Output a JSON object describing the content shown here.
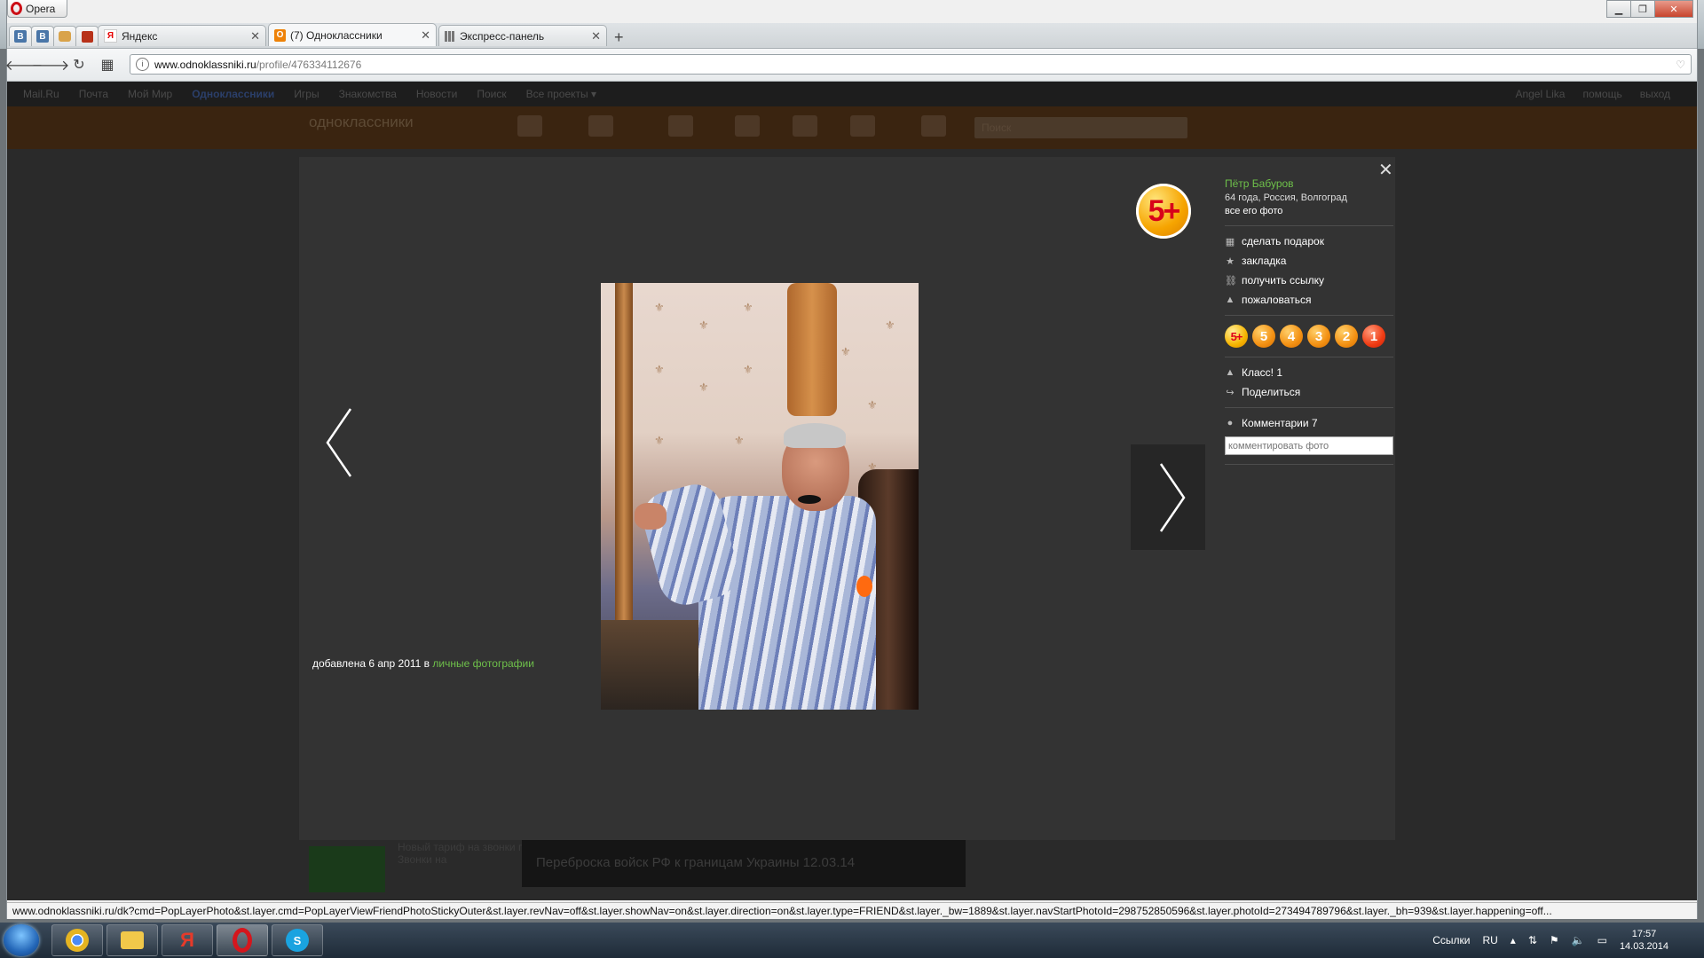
{
  "browser": {
    "app_name": "Opera",
    "pinned_tabs": [
      {
        "icon": "vk-icon",
        "glyph": "В"
      },
      {
        "icon": "vk-icon",
        "glyph": "В"
      },
      {
        "icon": "mail-ru-icon",
        "glyph": ""
      },
      {
        "icon": "game-icon",
        "glyph": ""
      }
    ],
    "tabs": [
      {
        "title": "Яндекс",
        "icon": "yandex-icon",
        "glyph": "Я",
        "active": false
      },
      {
        "title": "(7) Одноклассники",
        "icon": "odnoklassniki-icon",
        "glyph": "ok",
        "active": true
      },
      {
        "title": "Экспресс-панель",
        "icon": "speed-dial-icon",
        "glyph": "",
        "active": false
      }
    ],
    "new_tab_label": "+",
    "url_host": "www.odnoklassniki.ru",
    "url_path": "/profile/476334112676",
    "status_url": "www.odnoklassniki.ru/dk?cmd=PopLayerPhoto&st.layer.cmd=PopLayerViewFriendPhotoStickyOuter&st.layer.revNav=off&st.layer.showNav=on&st.layer.direction=on&st.layer.type=FRIEND&st.layer._bw=1889&st.layer.navStartPhotoId=298752850596&st.layer.photoId=273494789796&st.layer._bh=939&st.layer.happening=off..."
  },
  "ok_background": {
    "topnav": [
      "Mail.Ru",
      "Почта",
      "Мой Мир",
      "Одноклассники",
      "Игры",
      "Знакомства",
      "Новости",
      "Поиск",
      "Все проекты ▾"
    ],
    "topnav_right": [
      "Angel Lika",
      "помощь",
      "выход"
    ],
    "logo_text": "одноклассники",
    "search_placeholder": "Поиск",
    "news_text": "Переброска войск РФ к границам Украины 12.03.14",
    "ad_text": "Новый тариф на звонки по России! Звонки на"
  },
  "photo_viewer": {
    "close_glyph": "✕",
    "added_text": "добавлена 6 апр 2011 в ",
    "album_link": "личные фотографии",
    "rating_badge": "5+",
    "author": {
      "name": "Пётр Бабуров",
      "meta": "64 года, Россия, Волгоград",
      "all_photos": "все его фото"
    },
    "actions": [
      {
        "icon": "gift-icon",
        "glyph": "▦",
        "label": "сделать подарок"
      },
      {
        "icon": "star-icon",
        "glyph": "★",
        "label": "закладка"
      },
      {
        "icon": "link-icon",
        "glyph": "⛓",
        "label": "получить ссылку"
      },
      {
        "icon": "warning-icon",
        "glyph": "▲",
        "label": "пожаловаться"
      }
    ],
    "grades": [
      "5+",
      "5",
      "4",
      "3",
      "2",
      "1"
    ],
    "klass": {
      "icon": "thumb-up-icon",
      "glyph": "👍",
      "label": "Класс! 1"
    },
    "share": {
      "icon": "share-icon",
      "glyph": "↪",
      "label": "Поделиться"
    },
    "comments": {
      "icon": "comment-icon",
      "glyph": "●",
      "label": "Комментарии 7"
    },
    "comment_placeholder": "комментировать фото"
  },
  "taskbar": {
    "apps": [
      {
        "name": "chrome",
        "color": "#e8b222"
      },
      {
        "name": "explorer",
        "color": "#f1c84a"
      },
      {
        "name": "yandex-browser",
        "color": "#e53a2a"
      },
      {
        "name": "opera",
        "color": "#d4161d"
      },
      {
        "name": "skype",
        "color": "#1aa3e0"
      }
    ],
    "tray_links": "Ссылки",
    "lang": "RU",
    "time": "17:57",
    "date": "14.03.2014"
  }
}
